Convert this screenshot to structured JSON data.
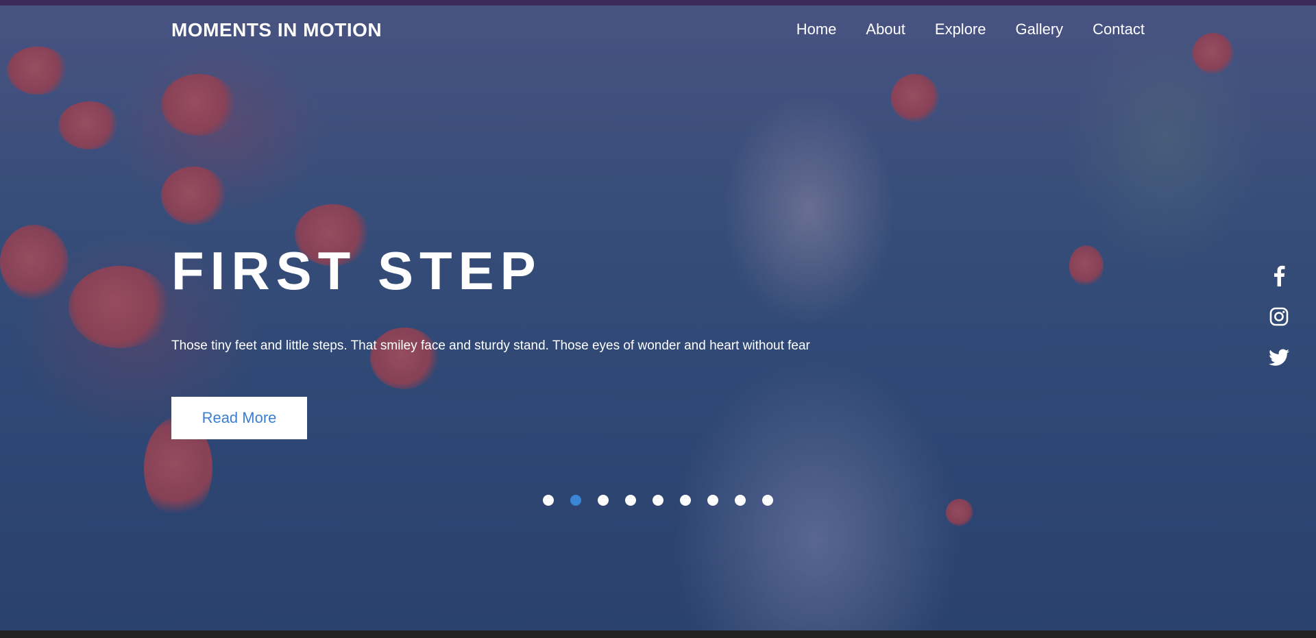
{
  "brand": "MOMENTS IN MOTION",
  "nav": [
    {
      "label": "Home"
    },
    {
      "label": "About"
    },
    {
      "label": "Explore"
    },
    {
      "label": "Gallery"
    },
    {
      "label": "Contact"
    }
  ],
  "hero": {
    "title": "FIRST STEP",
    "subtitle": "Those tiny feet and little steps. That smiley face and sturdy stand. Those eyes of wonder and heart without fear",
    "cta_label": "Read More",
    "slides_total": 9,
    "active_slide": 2
  },
  "social": [
    {
      "icon": "facebook-icon"
    },
    {
      "icon": "instagram-icon"
    },
    {
      "icon": "twitter-icon"
    }
  ],
  "colors": {
    "overlay": "#28407a",
    "button_text": "#3b7fd4",
    "active_dot": "#3b86d6",
    "text": "#ffffff"
  }
}
